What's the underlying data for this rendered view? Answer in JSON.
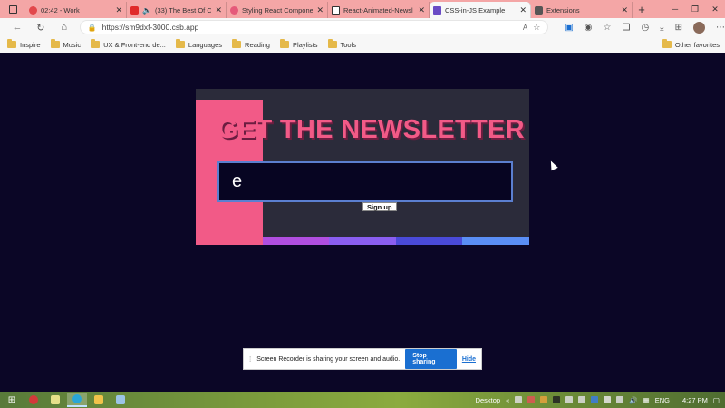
{
  "browser": {
    "tabs": [
      {
        "label": "02:42 - Work",
        "color": "#e2474b",
        "active": false
      },
      {
        "label": "(33) The Best Of C",
        "color": "#e02a2a",
        "active": false
      },
      {
        "label": "Styling React Compone",
        "color": "#e55a7a",
        "active": false
      },
      {
        "label": "React-Animated-Newsl",
        "color": "#333333",
        "active": false
      },
      {
        "label": "CSS-in-JS Example",
        "color": "#6a4bc5",
        "active": true
      },
      {
        "label": "Extensions",
        "color": "#555555",
        "active": false
      }
    ],
    "url": "https://sm9dxf-3000.csb.app",
    "bookmarks": [
      "Inspire",
      "Music",
      "UX & Front-end de...",
      "Languages",
      "Reading",
      "Playlists",
      "Tools"
    ],
    "other_favorites": "Other favorites"
  },
  "page": {
    "headline": "GET THE NEWSLETTER",
    "email_value": "e",
    "signup_label": "Sign up",
    "accent_color": "#f25a87",
    "stripe_colors": [
      "#b04ee0",
      "#8a5ef0",
      "#4a4ad8",
      "#5a8ef5"
    ]
  },
  "share_bar": {
    "message": "Screen Recorder is sharing your screen and audio.",
    "stop_label": "Stop sharing",
    "hide_label": "Hide"
  },
  "taskbar": {
    "desktop_label": "Desktop",
    "language": "ENG",
    "time": "4:27 PM"
  }
}
